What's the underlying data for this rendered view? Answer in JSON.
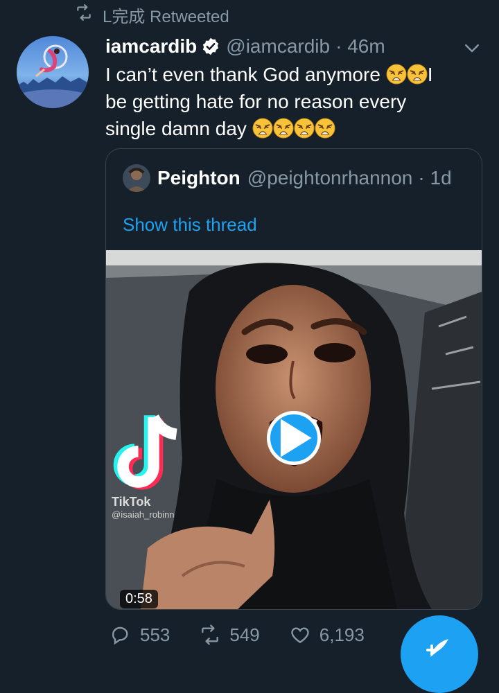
{
  "retweet": {
    "label": "L完成 Retweeted",
    "icon": "retweet-icon"
  },
  "tweet": {
    "author_name": "iamcardib",
    "verified": true,
    "handle": "@iamcardib",
    "time": "· 46m",
    "text_line1": "I can’t even thank God anymore ",
    "text_line1_end": "I",
    "text_line2": "be getting hate for no reason every",
    "text_line3": "single damn day ",
    "emoji": "weary-face-emoji"
  },
  "quote": {
    "author_name": "Peighton",
    "handle": "@peightonrhannon",
    "time": "· 1d",
    "thread_link": "Show this thread",
    "media": {
      "watermark_brand": "TikTok",
      "watermark_user": "@isaiah_robinn",
      "duration": "0:58"
    }
  },
  "actions": {
    "replies": "553",
    "retweets": "549",
    "likes": "6,193"
  },
  "colors": {
    "background": "#15202b",
    "accent": "#1da1f2",
    "muted": "#8899a6",
    "border": "#38444d"
  }
}
